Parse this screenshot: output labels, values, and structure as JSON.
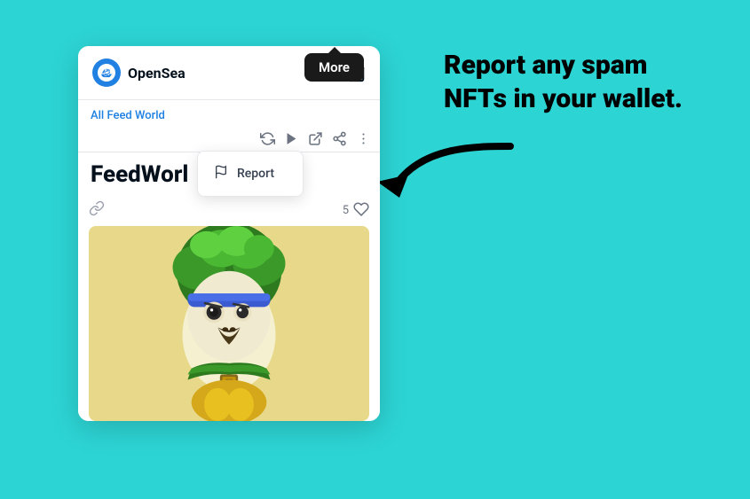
{
  "background_color": "#2dd4d4",
  "annotation": {
    "text": "Report any spam NFTs\nin your wallet.",
    "color": "#000000"
  },
  "browser": {
    "brand": "OpenSea",
    "breadcrumb": {
      "link": "All Feed World"
    },
    "toolbar": {
      "icons": [
        "refresh",
        "play",
        "external",
        "share",
        "more-dots"
      ]
    },
    "more_tooltip": "More",
    "page_title": "FeedWorl",
    "report_menu": {
      "items": [
        {
          "label": "Report",
          "icon": "flag"
        }
      ]
    },
    "nft_card": {
      "likes": "5",
      "like_icon": "heart"
    }
  }
}
